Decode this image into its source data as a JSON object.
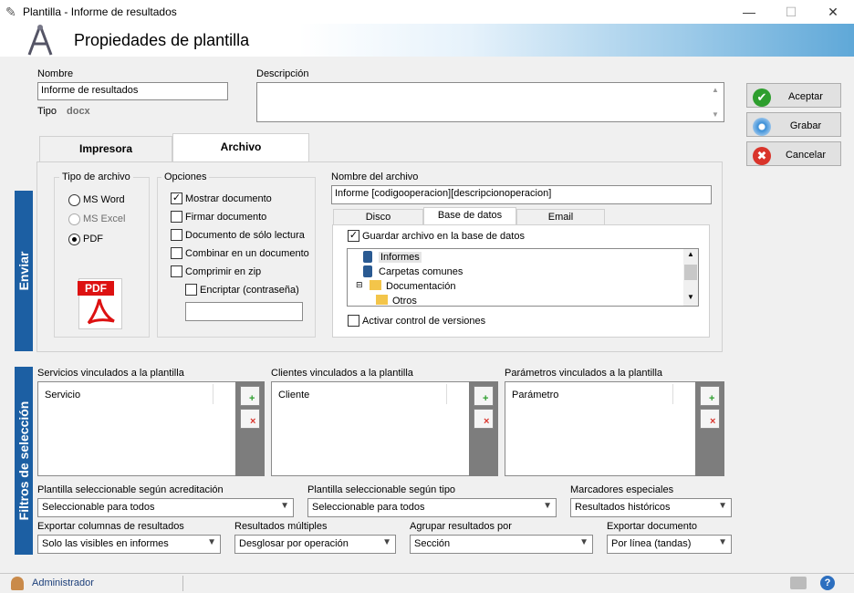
{
  "window": {
    "title": "Plantilla - Informe de resultados",
    "minimize": "—",
    "maximize": "☐",
    "close": "✕"
  },
  "header": {
    "title": "Propiedades de plantilla"
  },
  "form": {
    "nombre_label": "Nombre",
    "nombre_value": "Informe de resultados",
    "tipo_label": "Tipo",
    "tipo_value": "docx",
    "descripcion_label": "Descripción",
    "descripcion_value": ""
  },
  "buttons": {
    "aceptar": "Aceptar",
    "grabar": "Grabar",
    "cancelar": "Cancelar"
  },
  "tabs": [
    {
      "label": "Impresora"
    },
    {
      "label": "Archivo"
    }
  ],
  "sidebars": {
    "enviar": "Enviar",
    "filtros": "Filtros de selección"
  },
  "tipo_archivo": {
    "title": "Tipo de archivo",
    "options": [
      {
        "label": "MS Word"
      },
      {
        "label": "MS Excel"
      },
      {
        "label": "PDF"
      }
    ],
    "pdf_icon": "PDF"
  },
  "opciones": {
    "title": "Opciones",
    "items": [
      {
        "label": "Mostrar documento",
        "checked": true
      },
      {
        "label": "Firmar documento",
        "checked": false
      },
      {
        "label": "Documento de sólo lectura",
        "checked": false
      },
      {
        "label": "Combinar en un documento",
        "checked": false
      },
      {
        "label": "Comprimir en zip",
        "checked": false
      },
      {
        "label": "Encriptar (contraseña)",
        "checked": false
      }
    ],
    "password_value": ""
  },
  "nombre_archivo": {
    "label": "Nombre del archivo",
    "value": "Informe [codigooperacion][descripcionoperacion]"
  },
  "subtabs": [
    {
      "label": "Disco"
    },
    {
      "label": "Base de datos"
    },
    {
      "label": "Email"
    }
  ],
  "base_datos": {
    "guardar_label": "Guardar archivo en la base de datos",
    "tree": [
      {
        "label": "Informes"
      },
      {
        "label": "Carpetas comunes"
      },
      {
        "label": "Documentación"
      },
      {
        "label": "Otros"
      }
    ],
    "versiones_label": "Activar control de versiones"
  },
  "vinculados": [
    {
      "title": "Servicios vinculados a la plantilla",
      "column": "Servicio"
    },
    {
      "title": "Clientes vinculados a la plantilla",
      "column": "Cliente"
    },
    {
      "title": "Parámetros vinculados a la plantilla",
      "column": "Parámetro"
    }
  ],
  "combos": [
    {
      "label": "Plantilla seleccionable según acreditación",
      "value": "Seleccionable para todos"
    },
    {
      "label": "Plantilla seleccionable según tipo",
      "value": "Seleccionable para todos"
    },
    {
      "label": "Marcadores especiales",
      "value": "Resultados históricos"
    },
    {
      "label": "Exportar columnas de resultados",
      "value": "Solo las visibles en informes"
    },
    {
      "label": "Resultados múltiples",
      "value": "Desglosar por operación"
    },
    {
      "label": "Agrupar resultados por",
      "value": "Sección"
    },
    {
      "label": "Exportar documento",
      "value": "Por línea (tandas)"
    }
  ],
  "status": {
    "user": "Administrador"
  },
  "colors": {
    "accent": "#1c5fa3",
    "ok": "#2e9e2e",
    "cancel": "#d9342b"
  }
}
